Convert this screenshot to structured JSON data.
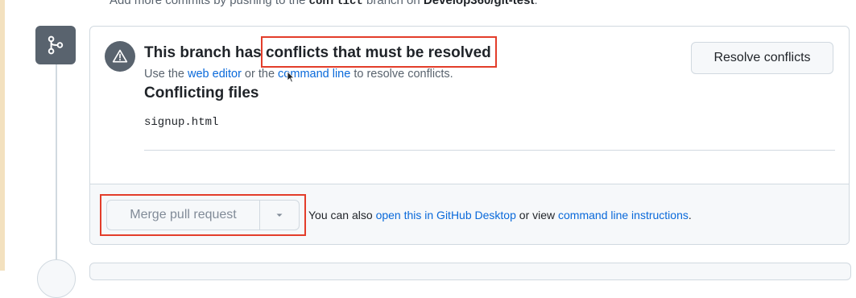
{
  "top_line": {
    "prefix": "Add more commits by pushing to the ",
    "branch": "conflict",
    "middle": " branch on ",
    "repo": "Develop360/git-test",
    "suffix": "."
  },
  "conflict_alert": {
    "headline_prefix": "This branch has ",
    "headline_highlight": "conflicts that must be resolved",
    "sub_prefix": "Use the ",
    "web_editor_link": "web editor",
    "sub_middle": " or the ",
    "command_line_link": "command line",
    "sub_suffix": " to resolve conflicts.",
    "resolve_button": "Resolve conflicts"
  },
  "conflicting_files": {
    "title": "Conflicting files",
    "files": [
      "signup.html"
    ]
  },
  "merge": {
    "button_label": "Merge pull request",
    "helper_prefix": "You can also ",
    "desktop_link": "open this in GitHub Desktop",
    "helper_middle": " or view ",
    "instructions_link": "command line instructions",
    "helper_suffix": "."
  },
  "colors": {
    "annotation_red": "#e33d2a",
    "link_blue": "#0969da",
    "badge_gray": "#59636e"
  }
}
